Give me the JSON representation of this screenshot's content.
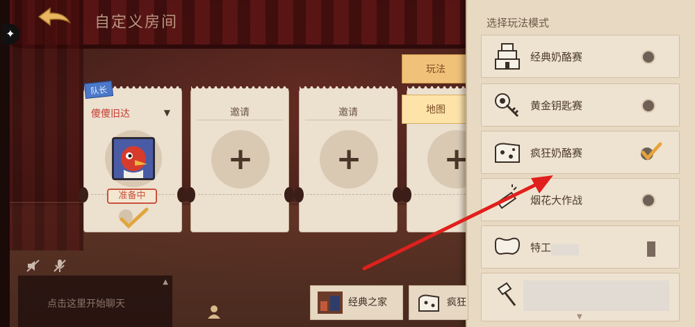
{
  "header": {
    "title": "自定义房间"
  },
  "team": {
    "captain_tag": "队长",
    "captain_name": "傻傻旧达",
    "status": "准备中",
    "invite_label": "邀请"
  },
  "side_tabs": [
    {
      "label": "玩法"
    },
    {
      "label": "地图"
    }
  ],
  "mode_panel": {
    "title": "选择玩法模式",
    "modes": [
      {
        "label": "经典奶酪赛",
        "selected": false,
        "icon": "cheese-stack-icon"
      },
      {
        "label": "黄金钥匙赛",
        "selected": false,
        "icon": "golden-key-icon"
      },
      {
        "label": "疯狂奶酪赛",
        "selected": true,
        "icon": "crazy-cheese-icon"
      },
      {
        "label": "烟花大作战",
        "selected": false,
        "icon": "firework-icon"
      },
      {
        "label": "特工",
        "selected": false,
        "icon": "bone-icon"
      }
    ]
  },
  "chat": {
    "placeholder": "点击这里开始聊天"
  },
  "maps": [
    {
      "label": "经典之家"
    },
    {
      "label": "疯狂"
    }
  ],
  "colors": {
    "accent": "#f0c179",
    "arrow": "#e0201c",
    "captain_name": "#c43a2e"
  }
}
